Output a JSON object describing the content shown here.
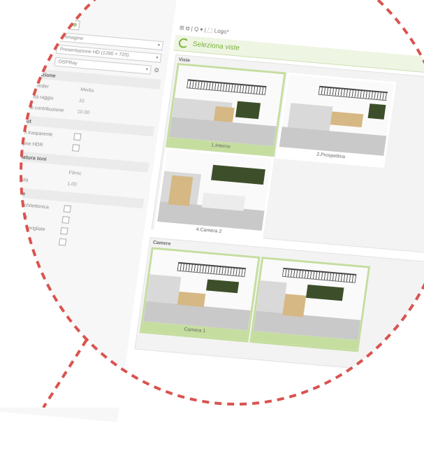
{
  "toolbar": {
    "view_tools": "⊞ ⧉ | Q ▾ | ⬚ Logo*"
  },
  "render_settings": {
    "rows": [
      {
        "label": "",
        "value": "Immagine"
      },
      {
        "label": "Risoluzione",
        "value": "Presentazione HD (1280 × 720)"
      },
      {
        "label": "Motore",
        "value": "OSPRay"
      }
    ]
  },
  "sections": {
    "illumination": {
      "title": "In lavorazione",
      "props": [
        {
          "k": "Qualità render",
          "v": "Media"
        },
        {
          "k": "Profondità raggio",
          "v": "10"
        },
        {
          "k": "Soglia di contribuzione",
          "v": "10.00"
        }
      ]
    },
    "output": {
      "title": "Output",
      "props": [
        {
          "k": "Sfondo trasparente"
        },
        {
          "k": "Immagine HDR"
        }
      ]
    },
    "tone": {
      "title": "Mappatura toni",
      "props": [
        {
          "k": "Metodo",
          "v": "Filmic"
        },
        {
          "k": "Luminosità",
          "v": "1.00"
        }
      ]
    },
    "special": {
      "title": "Speciale",
      "props": [
        {
          "k": "Camera architettonica"
        },
        {
          "k": "Piano ombra"
        },
        {
          "k": "Riflessioni smerigliate"
        },
        {
          "k": "Visualizza linee"
        }
      ]
    }
  },
  "views_panel": {
    "title": "Seleziona viste",
    "views_group": "Viste",
    "cameras_group": "Camere",
    "views": [
      {
        "caption": "1.Interno",
        "selected": true
      },
      {
        "caption": "2.Prospettiva",
        "selected": false
      },
      {
        "caption": "4.Camera 2",
        "selected": false
      }
    ],
    "cameras": [
      {
        "caption": "Camera 1",
        "selected": true
      },
      {
        "caption": "",
        "selected": true
      }
    ]
  },
  "colors": {
    "accent": "#7ab33a",
    "selected_thumb": "#c5dd9f",
    "dashed_circle": "#d9534f"
  }
}
